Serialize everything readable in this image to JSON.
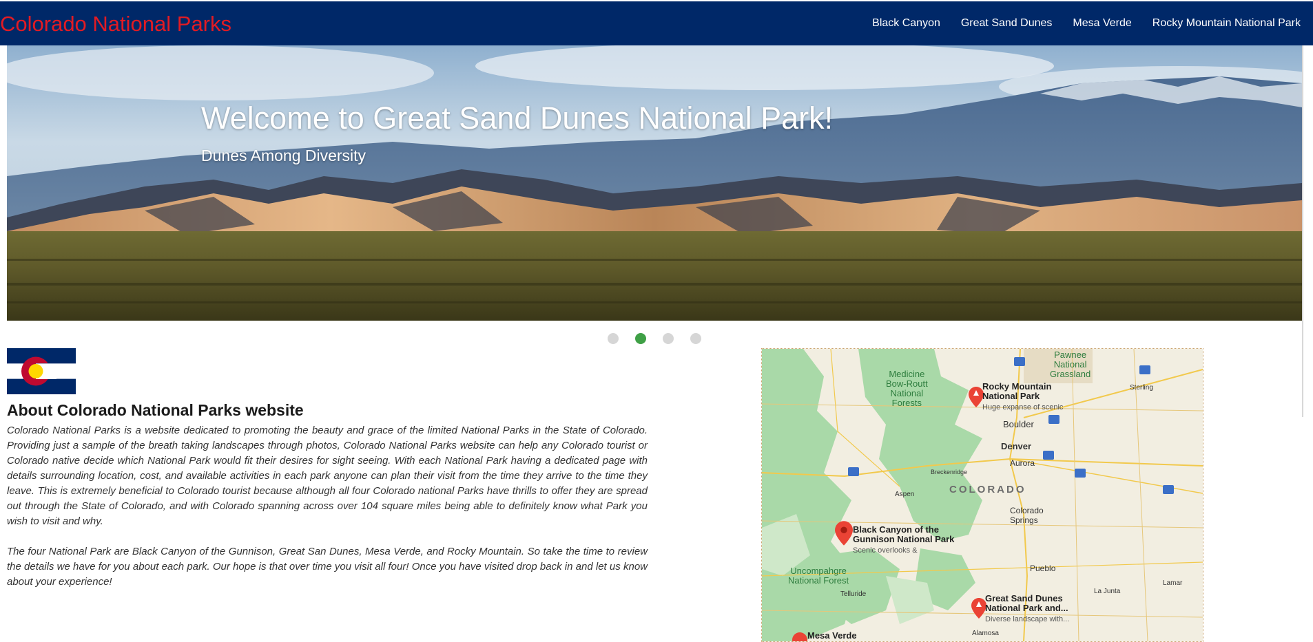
{
  "header": {
    "brand": "Colorado National Parks",
    "nav": [
      "Black Canyon",
      "Great Sand Dunes",
      "Mesa Verde",
      "Rocky Mountain National Park"
    ]
  },
  "hero": {
    "title": "Welcome to Great Sand Dunes National Park!",
    "subtitle": "Dunes Among Diversity",
    "slides_count": 4,
    "active_slide": 2
  },
  "about": {
    "title": "About Colorado National Parks website",
    "paragraph1": "Colorado National Parks is a website dedicated to promoting the beauty and grace of the limited National Parks in the State of Colorado. Providing just a sample of the breath taking landscapes through photos, Colorado National Parks website can help any Colorado tourist or Colorado native decide which National Park would fit their desires for sight seeing. With each National Park having a dedicated page with details surrounding location, cost, and available activities in each park anyone can plan their visit from the time they arrive to the time they leave. This is extremely beneficial to Colorado tourist because although all four Colorado national Parks have thrills to offer they are spread out through the State of Colorado, and with Colorado spanning across over 104 square miles being able to definitely know what Park you wish to visit and why.",
    "paragraph2": "The four National Park are Black Canyon of the Gunnison, Great San Dunes, Mesa Verde, and Rocky Mountain. So take the time to review the details we have for you about each park. Our hope is that over time you visit all four! Once you have visited drop back in and let us know about your experience!"
  },
  "map": {
    "forest_medicine": "Medicine\nBow-Routt\nNational\nForests",
    "grassland_pawnee": "Pawnee\nNational\nGrassland",
    "forest_uncompahgre": "Uncompahgre\nNational Forest",
    "state": "COLORADO",
    "cities": {
      "boulder": "Boulder",
      "denver": "Denver",
      "aurora": "Aurora",
      "sterling": "Sterling",
      "breckenridge": "Breckenridge",
      "aspen": "Aspen",
      "colorado_springs": "Colorado\nSprings",
      "pueblo": "Pueblo",
      "la_junta": "La Junta",
      "lamar": "Lamar",
      "telluride": "Telluride",
      "alamosa": "Alamosa"
    },
    "parks": {
      "rocky_name": "Rocky Mountain\nNational Park",
      "rocky_desc": "Huge expanse of scenic",
      "black_name": "Black Canyon of the\nGunnison National Park",
      "black_desc": "Scenic overlooks &",
      "sand_name": "Great Sand Dunes\nNational Park and...",
      "sand_desc": "Diverse landscape with...",
      "mesa_name": "Mesa Verde"
    },
    "highways": [
      "25",
      "76",
      "76",
      "70",
      "70",
      "70",
      "70"
    ],
    "pin_color": "#ea4335",
    "land_color": "#f2eee1",
    "forest_color": "#a9d9a8"
  },
  "colors": {
    "header_bg": "#002868",
    "brand": "#e31b23",
    "dot_active": "#3fa046",
    "dot_inactive": "#d6d6d6"
  }
}
